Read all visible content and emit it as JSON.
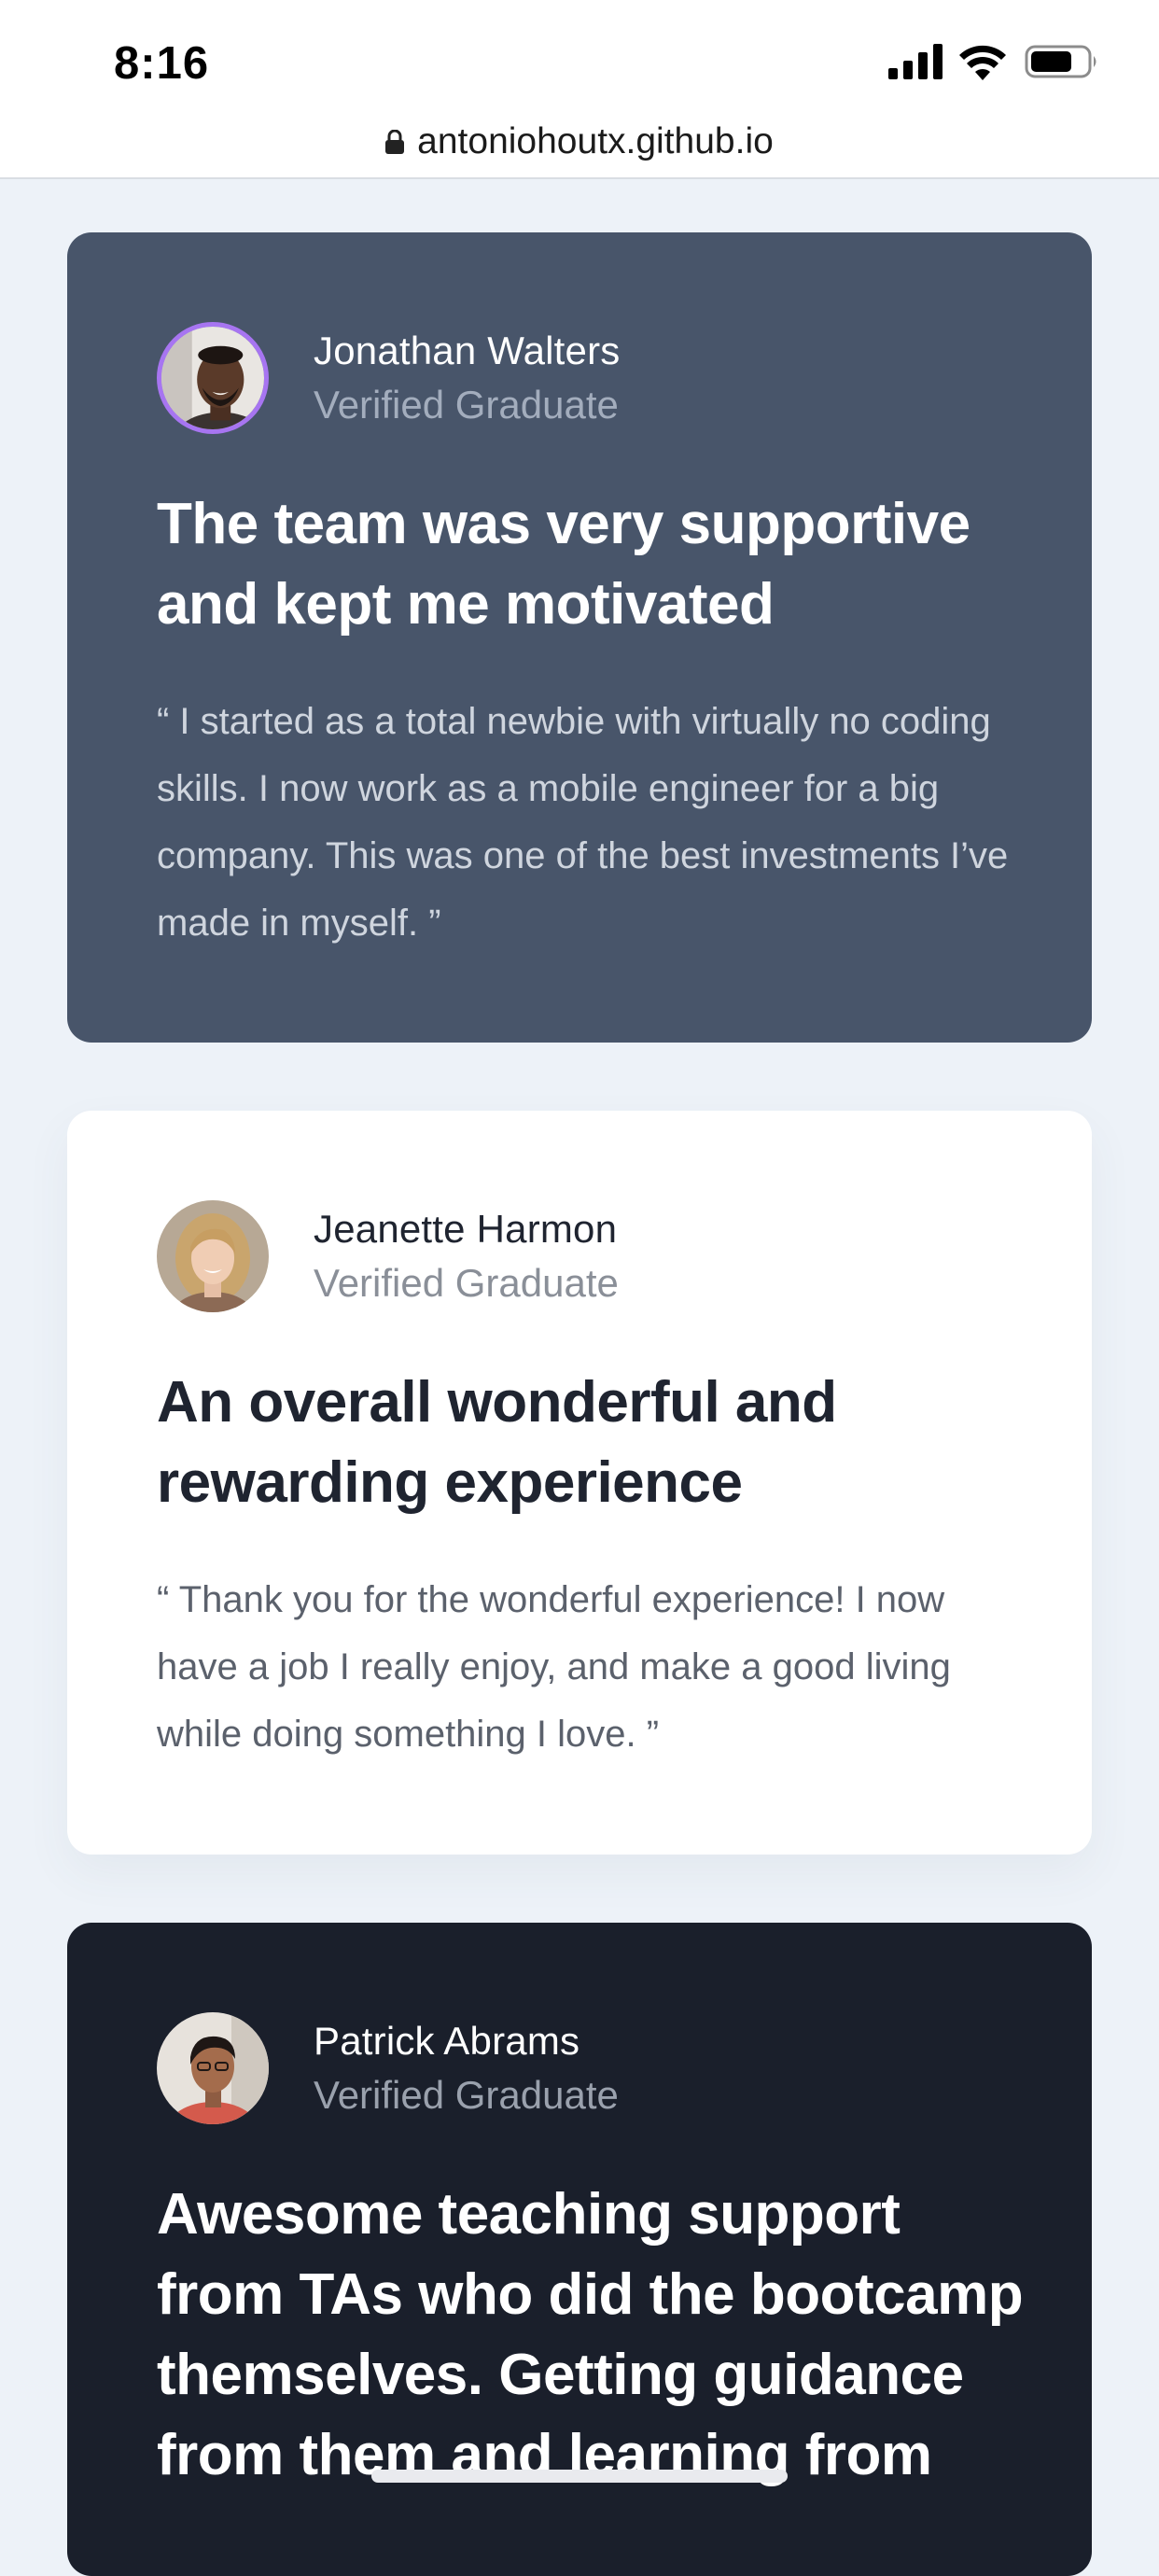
{
  "status_bar": {
    "time": "8:16",
    "icons": [
      "signal-icon",
      "wifi-icon",
      "battery-icon"
    ]
  },
  "url_bar": {
    "icon": "lock-icon",
    "url": "antoniohoutx.github.io"
  },
  "testimonials": [
    {
      "name": "Jonathan Walters",
      "role": "Verified Graduate",
      "headline": "The team was very supportive and kept me motivated",
      "quote": "“ I started as a total newbie with virtually no coding skills. I now work as a mobile engineer for a big company. This was one of the best investments I’ve made in myself. ”",
      "card_color": "#48556a"
    },
    {
      "name": "Jeanette Harmon",
      "role": "Verified Graduate",
      "headline": "An overall wonderful and rewarding experience",
      "quote": "“ Thank you for the wonderful experience! I now have a job I really enjoy, and make a good living while doing something I love. ”",
      "card_color": "#ffffff"
    },
    {
      "name": "Patrick Abrams",
      "role": "Verified Graduate",
      "headline": "Awesome teaching support from TAs who did the bootcamp themselves. Getting guidance from them and learning from",
      "card_color": "#1a1f2b"
    }
  ],
  "colors": {
    "page_background": "#edf2f8",
    "accent_border": "#a775f1"
  }
}
